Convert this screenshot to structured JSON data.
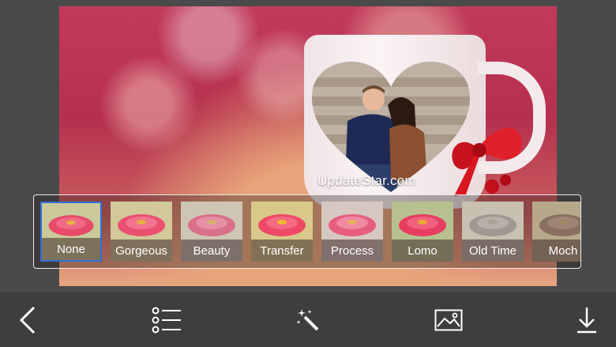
{
  "watermark": "UpdateStar.com",
  "filters": [
    {
      "label": "None",
      "selected": true
    },
    {
      "label": "Gorgeous",
      "selected": false
    },
    {
      "label": "Beauty",
      "selected": false
    },
    {
      "label": "Transfer",
      "selected": false
    },
    {
      "label": "Process",
      "selected": false
    },
    {
      "label": "Lomo",
      "selected": false
    },
    {
      "label": "Old Time",
      "selected": false
    },
    {
      "label": "Moch",
      "selected": false
    }
  ],
  "toolbar": {
    "icons": [
      "back-chevron-icon",
      "list-icon",
      "magic-wand-icon",
      "image-icon",
      "download-icon"
    ]
  },
  "colors": {
    "selection": "#2f6fd8",
    "toolbar_bg": "#3e3e3e",
    "app_bg": "#4a4a4a"
  }
}
